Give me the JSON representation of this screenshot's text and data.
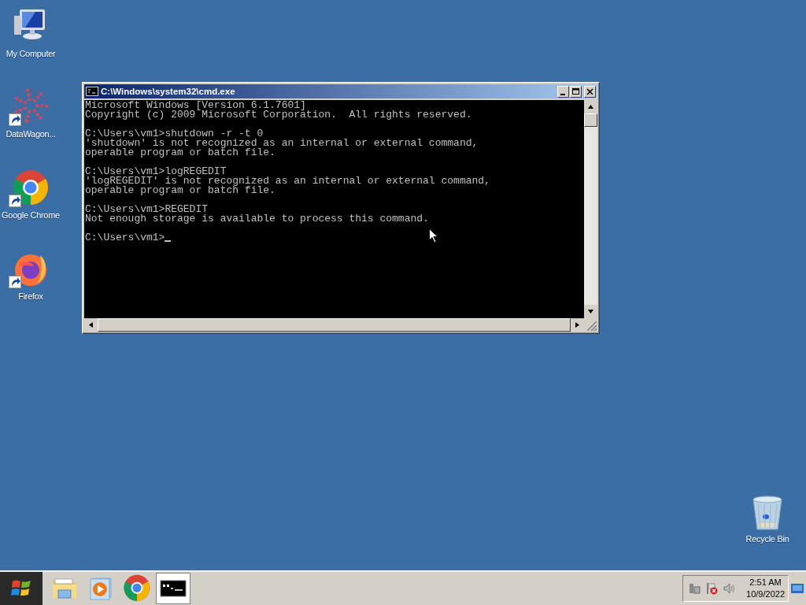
{
  "desktop_icons": [
    {
      "kind": "computer",
      "label": "My Computer",
      "shortcut": false
    },
    {
      "kind": "datawagon",
      "label": "DataWagon...",
      "shortcut": true
    },
    {
      "kind": "chrome",
      "label": "Google Chrome",
      "shortcut": true
    },
    {
      "kind": "firefox",
      "label": "Firefox",
      "shortcut": true
    },
    {
      "kind": "recycle",
      "label": "Recycle Bin",
      "shortcut": false
    }
  ],
  "window": {
    "title": "C:\\Windows\\system32\\cmd.exe",
    "console_blocks": [
      [
        "Microsoft Windows [Version 6.1.7601]",
        "Copyright (c) 2009 Microsoft Corporation.  All rights reserved."
      ],
      [
        "C:\\Users\\vm1>shutdown -r -t 0",
        "'shutdown' is not recognized as an internal or external command,",
        "operable program or batch file."
      ],
      [
        "C:\\Users\\vm1>logREGEDIT",
        "'logREGEDIT' is not recognized as an internal or external command,",
        "operable program or batch file."
      ],
      [
        "C:\\Users\\vm1>REGEDIT",
        "Not enough storage is available to process this command."
      ],
      [
        "C:\\Users\\vm1>"
      ]
    ],
    "cursor_visible": true
  },
  "taskbar": {
    "items": [
      {
        "kind": "explorer",
        "selected": false
      },
      {
        "kind": "media",
        "selected": false
      },
      {
        "kind": "chrome",
        "selected": false
      },
      {
        "kind": "cmd",
        "selected": true
      }
    ],
    "clock": {
      "time": "2:51 AM",
      "date": "10/9/2022"
    }
  }
}
